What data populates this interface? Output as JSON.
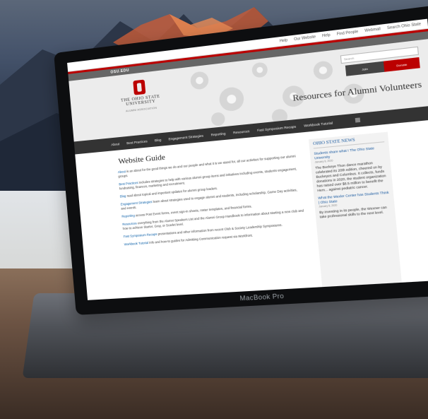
{
  "topbar": {
    "links": [
      "Help",
      "Our Website",
      "Help",
      "Find People",
      "Webmail",
      "Search Ohio State"
    ]
  },
  "osu_strip": "OSU.EDU",
  "header": {
    "logo_line1": "THE OHIO STATE",
    "logo_line2": "UNIVERSITY",
    "logo_line3": "ALUMNI ASSOCIATION",
    "title": "Resources for Alumni Volunteers",
    "search_placeholder": "Search",
    "join_label": "Join",
    "donate_label": "Donate"
  },
  "nav": {
    "items": [
      "About",
      "Best Practices",
      "Blog",
      "Engagement Strategies",
      "Reporting",
      "Resources",
      "Fast Symposium Recaps",
      "Workbook Tutorial"
    ]
  },
  "main": {
    "title": "Website Guide",
    "items": [
      {
        "link": "About",
        "text": "is an about for the good things we do and our people and what it is we stand for, all our activities for supporting our alumni groups."
      },
      {
        "link": "Best Practices",
        "text": "includes strategies to help with various alumni group items and initiatives including events, students engagement, fundraising, finances, marketing and recruitment."
      },
      {
        "link": "Blog",
        "text": "read about topical and important updates for alumni group leaders."
      },
      {
        "link": "Engagement Strategies",
        "text": "learn about strategies used to engage alumni and students, including scholarship, Game Day activities, and events."
      },
      {
        "link": "Reporting",
        "text": "access Post Event forms, event sign-in sheets, roster templates, and financial forms."
      },
      {
        "link": "Resources",
        "text": "everything from the Alumni Speakers List and the Alumni Group Handbook to information about starting a new club and how to achieve Starter, Gray, or Scarlet level."
      },
      {
        "link": "Fast Symposium Recaps",
        "text": "presentations and other information from recent Club & Society Leadership Symposiums."
      },
      {
        "link": "Workbook Tutorial",
        "text": "info and how-to guides for Admitting Communication request via Workfront."
      }
    ]
  },
  "sidebar": {
    "heading": "OHIO STATE NEWS",
    "news1_link": "Students share what I The Ohio State University",
    "news1_date": "January 8, 2020",
    "news1_text": "The Buckeye Thon dance marathon celebrated its 20th edition, cheered on by Buckeyes and Columbus. It collects, funds donations in 2020, the student organization has raised over $8.5 million to benefit the Hem... against pediatric cancer.",
    "news2_link": "What the Wexler Center has Students Think | Ohio State",
    "news2_date": "January 8, 2020",
    "news2_text": "By investing in its people, the Wexner can take professional skills to the next level."
  },
  "laptop_brand": "MacBook Pro"
}
